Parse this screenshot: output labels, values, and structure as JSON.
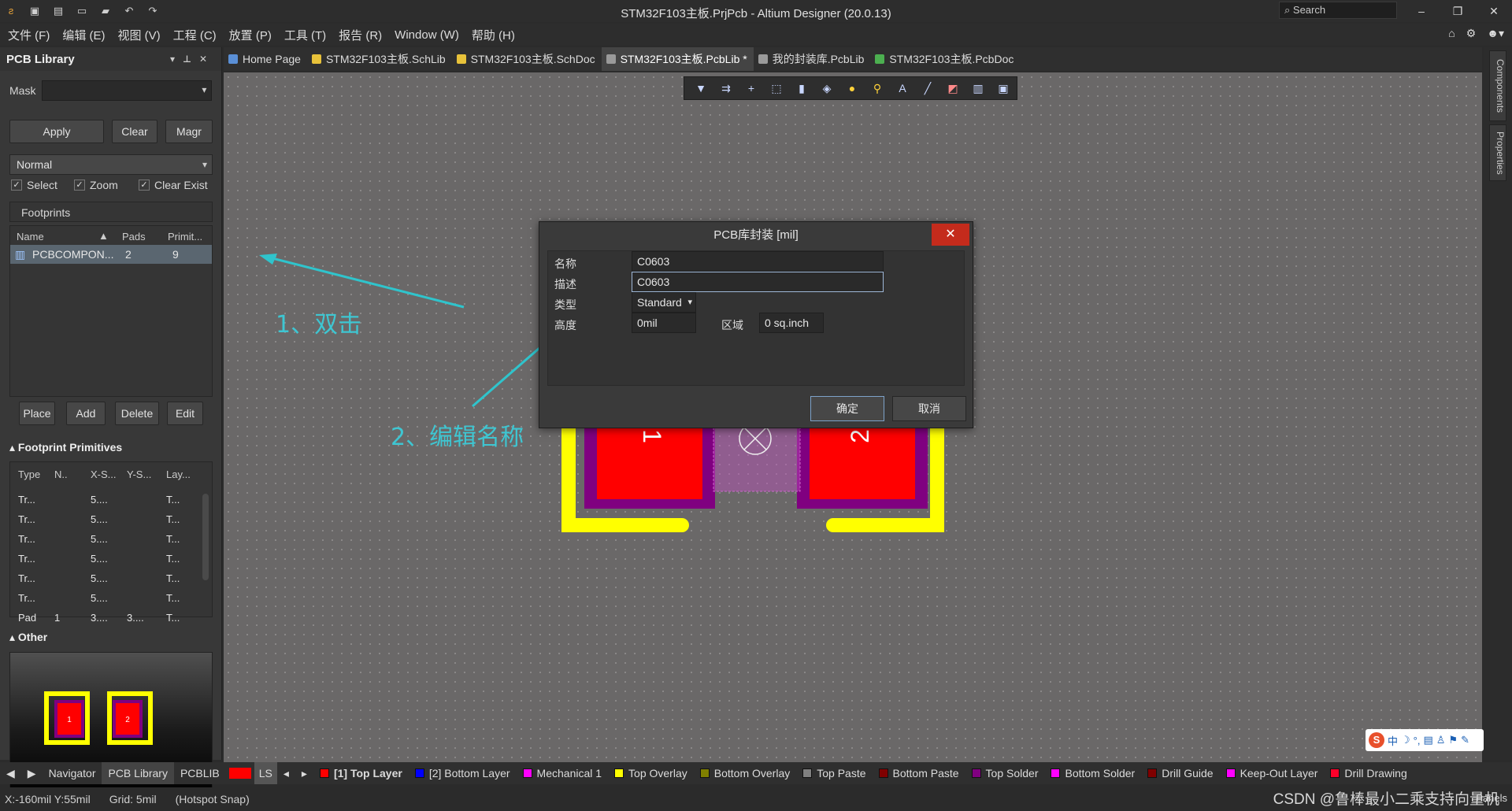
{
  "window": {
    "title": "STM32F103主板.PrjPcb - Altium Designer (20.0.13)",
    "search_placeholder": "Search"
  },
  "menu": [
    "文件 (F)",
    "编辑 (E)",
    "视图 (V)",
    "工程 (C)",
    "放置 (P)",
    "工具 (T)",
    "报告 (R)",
    "Window (W)",
    "帮助 (H)"
  ],
  "panel": {
    "title": "PCB Library",
    "mask_label": "Mask",
    "apply": "Apply",
    "clear": "Clear",
    "magnify": "Magr",
    "mode": "Normal",
    "select": "Select",
    "zoom": "Zoom",
    "clear_existing": "Clear Exist",
    "footprints_label": "Footprints",
    "cols": {
      "name": "Name",
      "pads": "Pads",
      "primitives": "Primit..."
    },
    "row": {
      "name": "PCBCOMPON...",
      "pads": "2",
      "primitives": "9"
    },
    "place": "Place",
    "add": "Add",
    "delete": "Delete",
    "edit": "Edit",
    "primitives_section": "Footprint Primitives",
    "prim_cols": [
      "Type",
      "N..",
      "X-S...",
      "Y-S...",
      "Lay..."
    ],
    "prim_rows": [
      [
        "Tr...",
        "",
        "5....",
        "",
        "T..."
      ],
      [
        "Tr...",
        "",
        "5....",
        "",
        "T..."
      ],
      [
        "Tr...",
        "",
        "5....",
        "",
        "T..."
      ],
      [
        "Tr...",
        "",
        "5....",
        "",
        "T..."
      ],
      [
        "Tr...",
        "",
        "5....",
        "",
        "T..."
      ],
      [
        "Tr...",
        "",
        "5....",
        "",
        "T..."
      ],
      [
        "Pad",
        "1",
        "3....",
        "3....",
        "T..."
      ]
    ],
    "other_section": "Other",
    "preview_pad1": "1",
    "preview_pad2": "2"
  },
  "tabs": [
    {
      "label": "Home Page",
      "color": "#5a8fd6"
    },
    {
      "label": "STM32F103主板.SchLib",
      "color": "#e8c23a"
    },
    {
      "label": "STM32F103主板.SchDoc",
      "color": "#e8c23a"
    },
    {
      "label": "STM32F103主板.PcbLib *",
      "color": "#9a9a9a"
    },
    {
      "label": "我的封装库.PcbLib",
      "color": "#9a9a9a"
    },
    {
      "label": "STM32F103主板.PcbDoc",
      "color": "#4caf50"
    }
  ],
  "canvas": {
    "pad1_label": "1",
    "pad2_label": "2",
    "annotation1": "1、双击",
    "annotation2": "2、编辑名称"
  },
  "dialog": {
    "title": "PCB库封装 [mil]",
    "name_label": "名称",
    "name_value": "C0603",
    "desc_label": "描述",
    "desc_value": "C0603",
    "type_label": "类型",
    "type_value": "Standard",
    "height_label": "高度",
    "height_value": "0mil",
    "area_label": "区域",
    "area_value": "0 sq.inch",
    "ok": "确定",
    "cancel": "取消"
  },
  "right_tabs": [
    "Components",
    "Properties"
  ],
  "bottom_tabs": [
    "Navigator",
    "PCB Library",
    "PCBLIB"
  ],
  "ls_label": "LS",
  "layers": [
    {
      "label": "[1] Top Layer",
      "color": "#ff0000"
    },
    {
      "label": "[2] Bottom Layer",
      "color": "#0000ff"
    },
    {
      "label": "Mechanical 1",
      "color": "#ff00ff"
    },
    {
      "label": "Top Overlay",
      "color": "#ffff00"
    },
    {
      "label": "Bottom Overlay",
      "color": "#808000"
    },
    {
      "label": "Top Paste",
      "color": "#808080"
    },
    {
      "label": "Bottom Paste",
      "color": "#800000"
    },
    {
      "label": "Top Solder",
      "color": "#800080"
    },
    {
      "label": "Bottom Solder",
      "color": "#ff00ff"
    },
    {
      "label": "Drill Guide",
      "color": "#800000"
    },
    {
      "label": "Keep-Out Layer",
      "color": "#ff00ff"
    },
    {
      "label": "Drill Drawing",
      "color": "#ff002a"
    }
  ],
  "status": {
    "coords": "X:-160mil Y:55mil",
    "grid": "Grid: 5mil",
    "snap": "(Hotspot Snap)",
    "panels": "Panels"
  },
  "watermark": "CSDN @鲁棒最小二乘支持向量机"
}
